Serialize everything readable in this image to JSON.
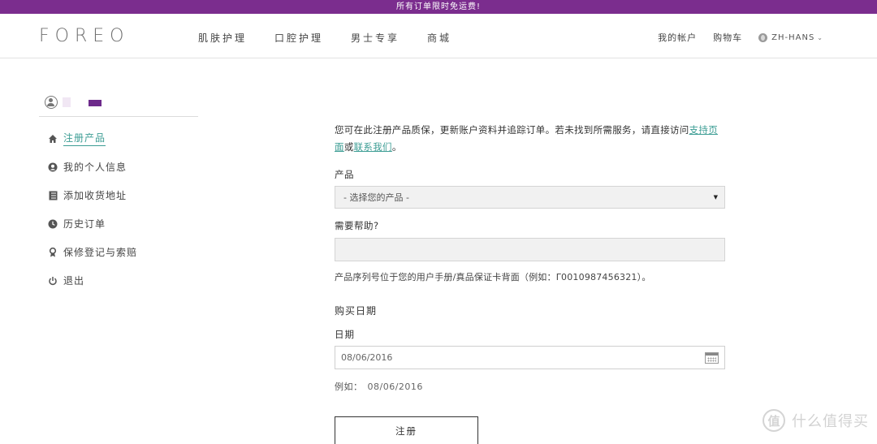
{
  "promo": {
    "text": "所有订单限时免运费!"
  },
  "header": {
    "logo": "FOREO",
    "nav": [
      "肌肤护理",
      "口腔护理",
      "男士专享",
      "商城"
    ],
    "account": "我的帐户",
    "cart": "购物车",
    "language": "ZH-HANS"
  },
  "sidebar": {
    "items": [
      {
        "label": "注册产品",
        "icon": "home-icon",
        "active": true
      },
      {
        "label": "我的个人信息",
        "icon": "user-circle-icon",
        "active": false
      },
      {
        "label": "添加收货地址",
        "icon": "address-book-icon",
        "active": false
      },
      {
        "label": "历史订单",
        "icon": "clock-icon",
        "active": false
      },
      {
        "label": "保修登记与索赔",
        "icon": "ribbon-icon",
        "active": false
      },
      {
        "label": "退出",
        "icon": "power-icon",
        "active": false
      }
    ]
  },
  "form": {
    "intro_text": "您可在此注册产品质保，更新账户资料并追踪订单。若未找到所需服务，请直接访问",
    "intro_link_support": "支持页面",
    "intro_or": "或",
    "intro_link_contact": "联系我们",
    "intro_end": "。",
    "product_label": "产品",
    "product_placeholder": "- 选择您的产品 -",
    "serial_label": "需要帮助?",
    "serial_value": "",
    "serial_hint": "产品序列号位于您的用户手册/真品保证卡背面（例如：Γ0010987456321）。",
    "purchase_section": "购买日期",
    "date_label": "日期",
    "date_value": "08/06/2016",
    "example_label": "例如：",
    "example_value": "08/06/2016",
    "submit_label": "注册"
  },
  "watermark": {
    "symbol": "值",
    "text": "什么值得买"
  },
  "colors": {
    "brand_purple": "#7b2d8e",
    "link_teal": "#3c9d94"
  }
}
